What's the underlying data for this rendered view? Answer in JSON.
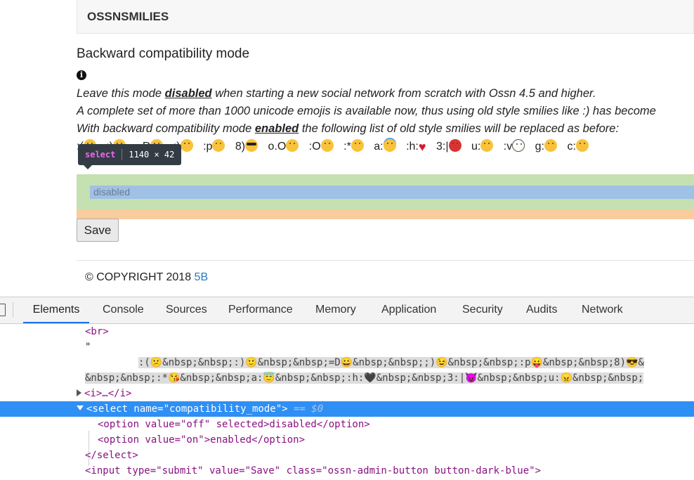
{
  "page": {
    "panel_title": "OSSNSMILIES",
    "section_title": "Backward compatibility mode",
    "info_icon": "info-circle-icon",
    "line1": {
      "pre": "Leave this mode ",
      "bold": "disabled",
      "post": " when starting a new social network from scratch with Ossn 4.5 and higher."
    },
    "line2": "A complete set of more than 1000 unicode emojis is available now, thus using old style smilies like :) has become",
    "line3": {
      "pre": "With backward compatibility mode ",
      "bold": "enabled",
      "post": " the following list of old style smilies will be replaced as before:"
    },
    "smilies": [
      ":(",
      ":)",
      "=D",
      ";)",
      ":p",
      "8)",
      "o.O",
      ":O",
      ":*",
      "a:",
      ":h:",
      "3:|",
      "u:",
      ":v",
      "g:",
      "c:"
    ],
    "select_value": "disabled",
    "save_label": "Save",
    "copyright_text": "© COPYRIGHT 2018 ",
    "copyright_link": "5B"
  },
  "tooltip": {
    "tag": "select",
    "size": "1140 × 42"
  },
  "devtools": {
    "tabs": [
      "Elements",
      "Console",
      "Sources",
      "Performance",
      "Memory",
      "Application",
      "Security",
      "Audits",
      "Network"
    ],
    "active_tab": "Elements",
    "lines": {
      "br": "<br>",
      "quote": "\"",
      "emoji_row1": ":(😕&nbsp;&nbsp;:)🙂&nbsp;&nbsp;=D😀&nbsp;&nbsp;;)😉&nbsp;&nbsp;:p😛&nbsp;&nbsp;8)😎&",
      "emoji_row2": "&nbsp;&nbsp;:*😘&nbsp;&nbsp;a:😇&nbsp;&nbsp;:h:🖤&nbsp;&nbsp;3:|😈&nbsp;&nbsp;u:😠&nbsp;&nbsp;",
      "i_collapsed": "<i>…</i>",
      "select_open": "<select name=\"compatibility_mode\">",
      "select_marker": " == $0",
      "option_off": "<option value=\"off\" selected>disabled</option>",
      "option_on": "<option value=\"on\">enabled</option>",
      "select_close": "</select>",
      "input_submit": "<input type=\"submit\" value=\"Save\" class=\"ossn-admin-button button-dark-blue\">"
    }
  }
}
